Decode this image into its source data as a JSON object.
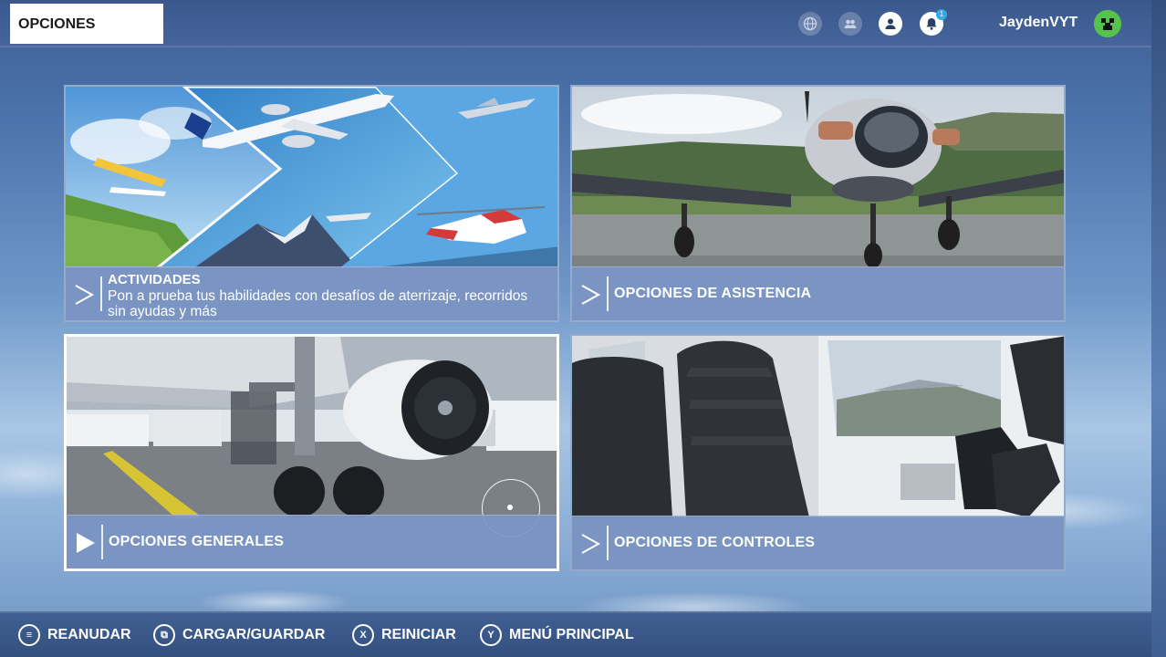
{
  "header": {
    "title": "OPCIONES",
    "icons": [
      "globe-icon",
      "friends-icon",
      "profile-icon",
      "notifications-icon"
    ],
    "notification_count": "1",
    "username": "JaydenVYT"
  },
  "cards": [
    {
      "title": "ACTIVIDADES",
      "description": "Pon a prueba tus habilidades con desafíos de aterrizaje, recorridos sin ayudas y más"
    },
    {
      "label": "OPCIONES DE ASISTENCIA"
    },
    {
      "label": "OPCIONES GENERALES"
    },
    {
      "label": "OPCIONES DE CONTROLES"
    }
  ],
  "footer": {
    "items": [
      {
        "icon": "menu-icon",
        "glyph": "≡",
        "label": "REANUDAR"
      },
      {
        "icon": "view-icon",
        "glyph": "⧉",
        "label": "CARGAR/GUARDAR"
      },
      {
        "icon": "x-button-icon",
        "glyph": "X",
        "label": "REINICIAR"
      },
      {
        "icon": "y-button-icon",
        "glyph": "Y",
        "label": "MENÚ PRINCIPAL"
      }
    ]
  },
  "colors": {
    "topbar": "#3a588c",
    "label_panel": "#7d96c4",
    "avatar": "#4fbf46"
  }
}
